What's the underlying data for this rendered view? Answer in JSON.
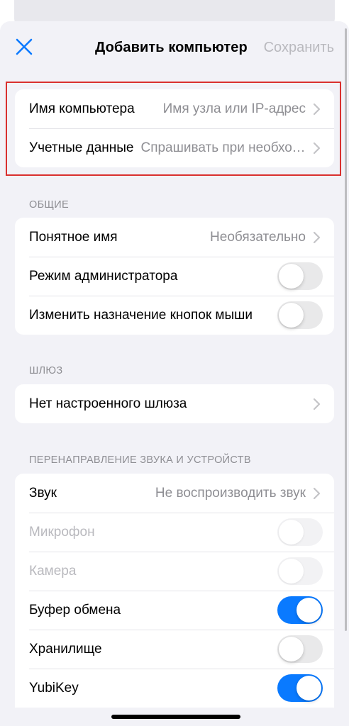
{
  "nav": {
    "title": "Добавить компьютер",
    "save_label": "Сохранить"
  },
  "connection": {
    "pc_name": {
      "label": "Имя компьютера",
      "value": "Имя узла или IP-адрес"
    },
    "credentials": {
      "label": "Учетные данные",
      "value": "Спрашивать при необходимости"
    }
  },
  "general": {
    "header": "ОБЩИЕ",
    "friendly_name": {
      "label": "Понятное имя",
      "value": "Необязательно"
    },
    "admin_mode": {
      "label": "Режим администратора",
      "on": false
    },
    "swap_buttons": {
      "label": "Изменить назначение кнопок мыши",
      "on": false
    }
  },
  "gateway": {
    "header": "ШЛЮЗ",
    "none": {
      "label": "Нет настроенного шлюза"
    }
  },
  "redirection": {
    "header": "ПЕРЕНАПРАВЛЕНИЕ ЗВУКА И УСТРОЙСТВ",
    "sound": {
      "label": "Звук",
      "value": "Не воспроизводить звук"
    },
    "microphone": {
      "label": "Микрофон",
      "on": false,
      "enabled": false
    },
    "camera": {
      "label": "Камера",
      "on": false,
      "enabled": false
    },
    "clipboard": {
      "label": "Буфер обмена",
      "on": true
    },
    "storage": {
      "label": "Хранилище",
      "on": false
    },
    "yubikey": {
      "label": "YubiKey",
      "on": true
    }
  },
  "colors": {
    "accent": "#0a7aff",
    "highlight_border": "#d9302e",
    "background": "#f2f2f7",
    "secondary_text": "#8e8e93"
  },
  "icons": [
    "close-icon",
    "chevron-right-icon"
  ]
}
